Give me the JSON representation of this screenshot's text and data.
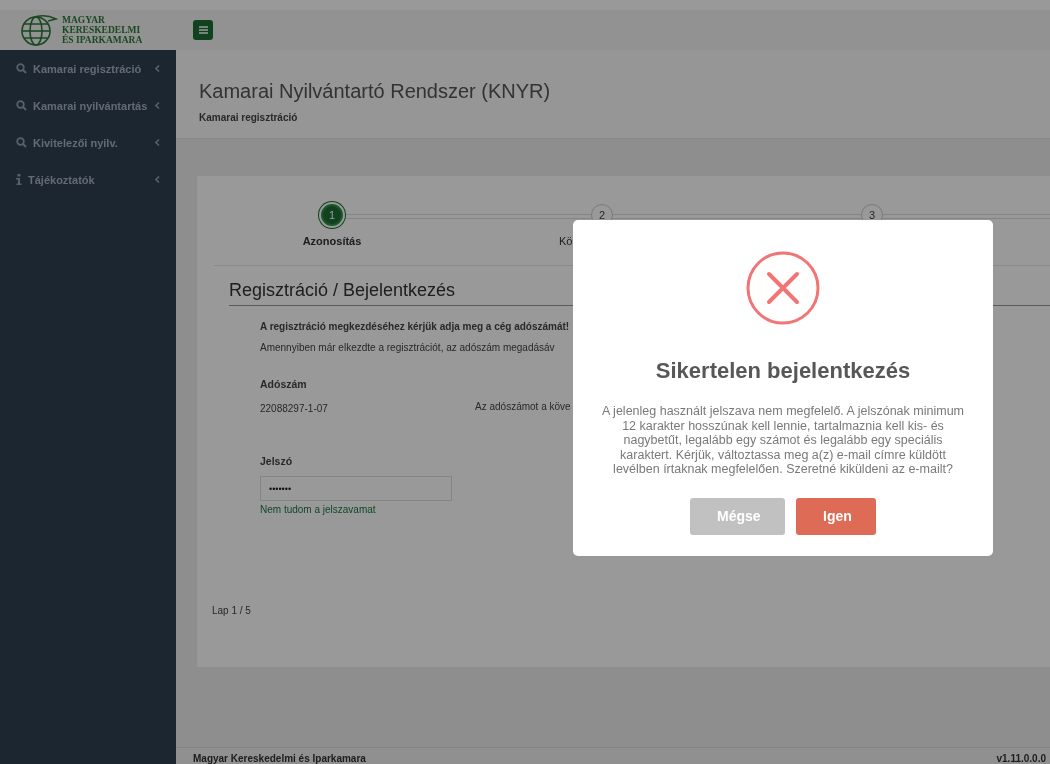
{
  "logo": {
    "lines": [
      "MAGYAR",
      "KERESKEDELMI",
      "ÉS IPARKAMARA"
    ]
  },
  "sidebar": {
    "items": [
      {
        "label": "Kamarai regisztráció",
        "kind": "search"
      },
      {
        "label": "Kamarai nyilvántartás",
        "kind": "search"
      },
      {
        "label": "Kivitelezői nyilv.",
        "kind": "search"
      },
      {
        "label": "Tájékoztatók",
        "kind": "info"
      }
    ]
  },
  "page": {
    "title": "Kamarai Nyilvántartó Rendszer (KNYR)",
    "subtitle": "Kamarai regisztráció"
  },
  "steps": [
    {
      "number": "1",
      "label": "Azonosítás",
      "selected": true
    },
    {
      "number": "2",
      "label": "Kö",
      "selected": false
    },
    {
      "number": "3",
      "selected": false
    }
  ],
  "form": {
    "heading": "Regisztráció / Bejelentkezés",
    "intro": "A regisztráció megkezdéséhez kérjük adja meg a cég adószámát!",
    "note": "Amennyiben már elkezdte a regisztrációt, az adószám megadásáv",
    "tax_label": "Adószám",
    "tax_value": "22088297-1-07",
    "tax_hint": "Az adószámot a köve",
    "password_label": "Jelszó",
    "password_value": "•••••••",
    "forgot_link": "Nem tudom a jelszavamat"
  },
  "pager": "Lap 1 / 5",
  "footer": {
    "left": "Magyar Kereskedelmi és Iparkamara",
    "right": "v1.11.0.0.0"
  },
  "modal": {
    "title": "Sikertelen bejelentkezés",
    "message": "A jelenleg használt jelszava nem megfelelő. A jelszónak minimum 12 karakter hosszúnak kell lennie, tartalmaznia kell kis- és nagybetűt, legalább egy számot és legalább egy speciális karaktert. Kérjük, változtassa meg a(z) e-mail címre küldött levélben írtaknak megfelelően. Szeretné kiküldeni az e-mailt?",
    "buttons": [
      {
        "label": "Mégse",
        "kind": "cancel"
      },
      {
        "label": "Igen",
        "kind": "confirm"
      }
    ]
  }
}
